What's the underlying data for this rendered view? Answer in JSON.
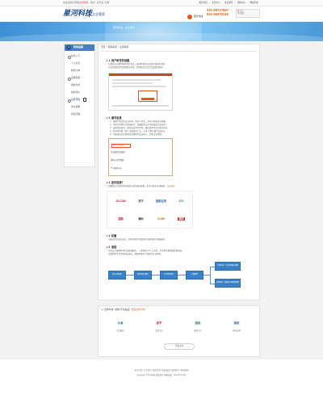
{
  "topbar": {
    "welcome_prefix": "欢迎来到星河科技",
    "welcome_brand": "企业管家",
    "welcome_suffix": "，您好！请 登录 / 注册",
    "links": [
      "服务项目",
      "业务中心",
      "会员服务",
      "帮助中心",
      "网站导航"
    ]
  },
  "header": {
    "logo_text": "星河科技",
    "logo_sub": "企业管家",
    "hotline_label": "服务热线",
    "phone1": "021-56717667",
    "phone2": "021-56376116",
    "qr_text": "扫一扫",
    "qr_sub": "关注微信"
  },
  "banner": {
    "text": "星河科技 · 企业管家"
  },
  "sidebar": {
    "title": "帮助指南",
    "badge": "?",
    "items": [
      {
        "label": "新手入门",
        "group": true
      },
      {
        "label": "个人信息",
        "group": false
      },
      {
        "label": "我的订单",
        "group": false
      },
      {
        "label": "注册指南",
        "group": true
      },
      {
        "label": "我的文件",
        "group": false
      },
      {
        "label": "我的评价",
        "group": false
      },
      {
        "label": "注册须知",
        "group": true
      },
      {
        "label": "支付说明",
        "group": false
      },
      {
        "label": "常见问题",
        "group": false
      }
    ]
  },
  "main": {
    "breadcrumb": "首页 > 帮助指南 > 注册指南",
    "s1_title": "1. 用户帐号的创建",
    "s1_p1": "在线提交注册资料并进行验证，选择需要的会员类型和服务项目。",
    "s1_p2": "完成注册后即可使用账号登录，管理您的企业业务及相关服务。",
    "s2_title": "2. 填写信息",
    "s2_lines": [
      "1、请填写真实的企业名称、联系人姓名、手机号码及电子邮箱。",
      "2、手机号码将作为登录账号，请确保可以正常接收短信验证码。",
      "3、设置登录密码，密码长度为6-20位，建议使用字母与数字组合。",
      "4、阅读并同意《用户注册协议》后，点击“立即注册”完成提交。",
      "5、注册成功后系统将自动跳转至会员中心，完善企业资料。"
    ],
    "s2_menu": [
      "账户信息管理",
      "企业基本信息维护",
      "资料与文件管理",
      "个人服务中心"
    ],
    "s3_title": "3. 如何选择？",
    "s3_p": "请根据企业实际需求选择合适的服务套餐，也可以联系在线客服。",
    "s3_hl": "点击咨询",
    "s4_title": "4. 优惠",
    "s4_p": "注册成为正式会员后，即可享受平台提供的专属优惠与增值服务。",
    "s5_title": "5. 流程",
    "s5_p1": "从提交注册资料到完成开通服务，一般需要1-3个工作日，平台将全程跟进办理进度。",
    "s5_p2": "如遇资料不全或审核未通过，客服将及时与您联系补充材料。",
    "flow": [
      "提交注册资料",
      "资料审核与确认",
      "支付服务费用",
      "开通服务",
      "办理完成，平台发送确认通知",
      "如有疑问，请联系在线客服咨询"
    ]
  },
  "logos": [
    {
      "text": "JD.COM",
      "color": "#c8102e"
    },
    {
      "text": "苏宁",
      "color": "#333333"
    },
    {
      "text": "国美在线",
      "color": "#1f5fb4"
    },
    {
      "text": "ZZS",
      "color": "#2e8b57"
    },
    {
      "text": "国美",
      "color": "#c8102e"
    },
    {
      "text": "海尔",
      "color": "#222222"
    },
    {
      "text": "GOME",
      "color": "#b8860b"
    },
    {
      "text": "美的",
      "color": "#d22d2d"
    }
  ],
  "partners": {
    "title_prefix": "合作伙伴",
    "title_note": "（排名不分先后）",
    "title_hl": "更多合作伙伴",
    "items": [
      {
        "logo": "水滴",
        "name": "企业服务",
        "color": "#2a7fc1"
      },
      {
        "logo": "苏宁",
        "name": "电商平台",
        "color": "#c8102e"
      },
      {
        "logo": "国美",
        "name": "零售平台",
        "color": "#2e8b57"
      },
      {
        "logo": "美的",
        "name": "家电品牌",
        "color": "#1f5fb4"
      }
    ],
    "more": "查看更多"
  },
  "footer": {
    "line1": "星河科技 | 关于我们 | 服务条款 | 隐私政策 | 联系我们 | 网站地图",
    "line2": "Copyright © 星河科技 版权所有  客服热线：021-56717667"
  }
}
